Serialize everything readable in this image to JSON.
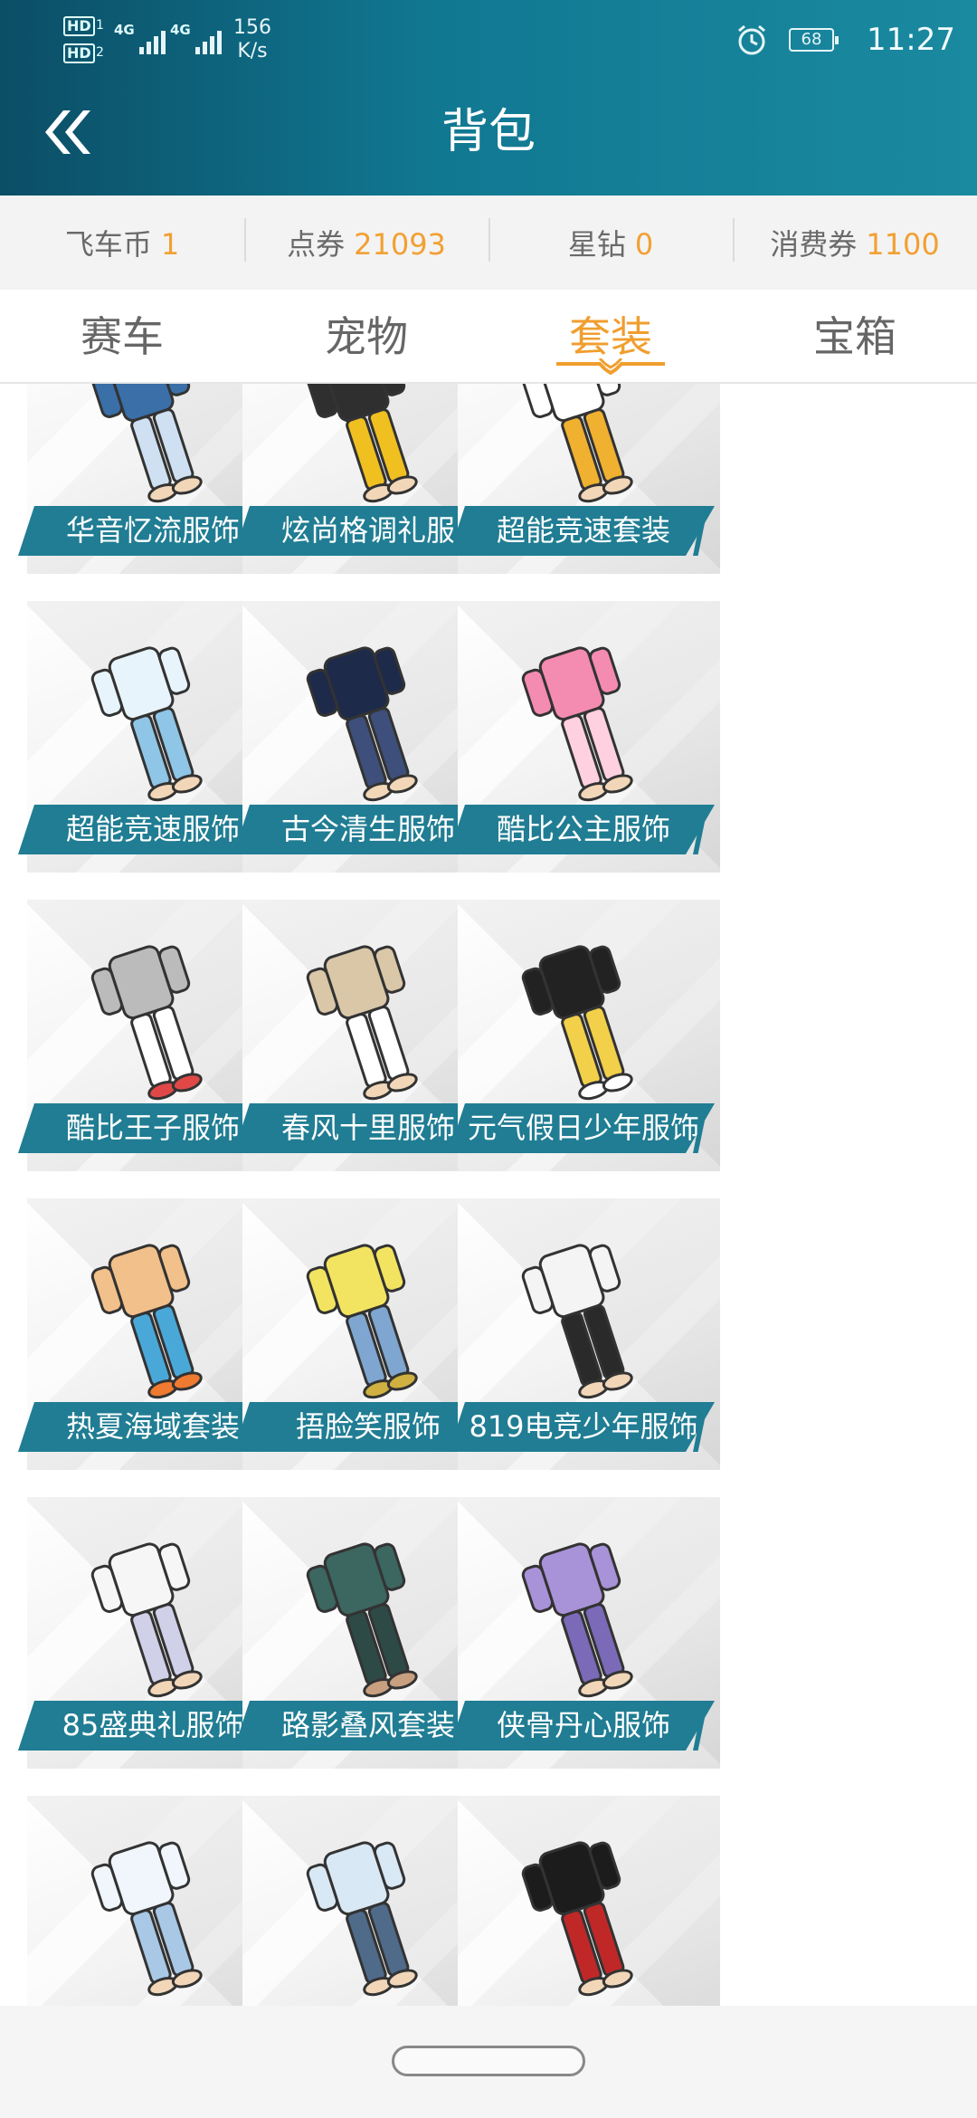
{
  "status_bar": {
    "hd1": "HD",
    "hd1_n": "1",
    "hd2": "HD",
    "hd2_n": "2",
    "net1": "4G",
    "net2": "4G",
    "speed": "156",
    "speed_unit": "K/s",
    "battery": "68",
    "time": "11:27"
  },
  "header": {
    "title": "背包",
    "back_icon": "double-chevron-left-icon",
    "gradient": [
      "#0b4e66",
      "#1a8aa0"
    ]
  },
  "currencies": [
    {
      "label": "飞车币",
      "value": "1"
    },
    {
      "label": "点券",
      "value": "21093"
    },
    {
      "label": "星钻",
      "value": "0"
    },
    {
      "label": "消费券",
      "value": "1100"
    }
  ],
  "tabs": [
    {
      "label": "赛车",
      "active": false
    },
    {
      "label": "宠物",
      "active": false
    },
    {
      "label": "套装",
      "active": true
    },
    {
      "label": "宝箱",
      "active": false
    }
  ],
  "items": [
    {
      "name": "华音忆流服饰"
    },
    {
      "name": "炫尚格调礼服"
    },
    {
      "name": "超能竞速套装"
    },
    {
      "name": "超能竞速服饰"
    },
    {
      "name": "古今清生服饰"
    },
    {
      "name": "酷比公主服饰"
    },
    {
      "name": "酷比王子服饰"
    },
    {
      "name": "春风十里服饰"
    },
    {
      "name": "元气假日少年服饰"
    },
    {
      "name": "热夏海域套装"
    },
    {
      "name": "捂脸笑服饰"
    },
    {
      "name": "819电竞少年服饰"
    },
    {
      "name": "85盛典礼服饰"
    },
    {
      "name": "路影叠风套装"
    },
    {
      "name": "侠骨丹心服饰"
    },
    {
      "name": ""
    },
    {
      "name": ""
    },
    {
      "name": ""
    }
  ],
  "colors": {
    "accent": "#f09e2e",
    "label_bg": "#207d93",
    "currency_value": "#f2a032"
  }
}
